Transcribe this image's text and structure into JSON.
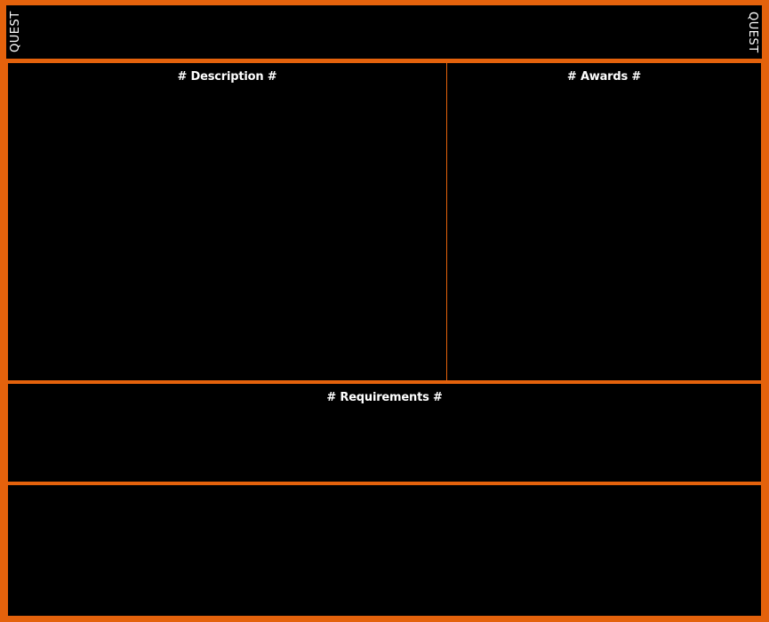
{
  "header": {
    "left_label": "QUEST",
    "right_label": "QUEST"
  },
  "description": {
    "title": "# Description #"
  },
  "awards": {
    "title": "# Awards #"
  },
  "requirements": {
    "title": "# Requirements #"
  },
  "colors": {
    "frame": "#e4620c",
    "panel": "#000000",
    "text": "#ffffff"
  }
}
